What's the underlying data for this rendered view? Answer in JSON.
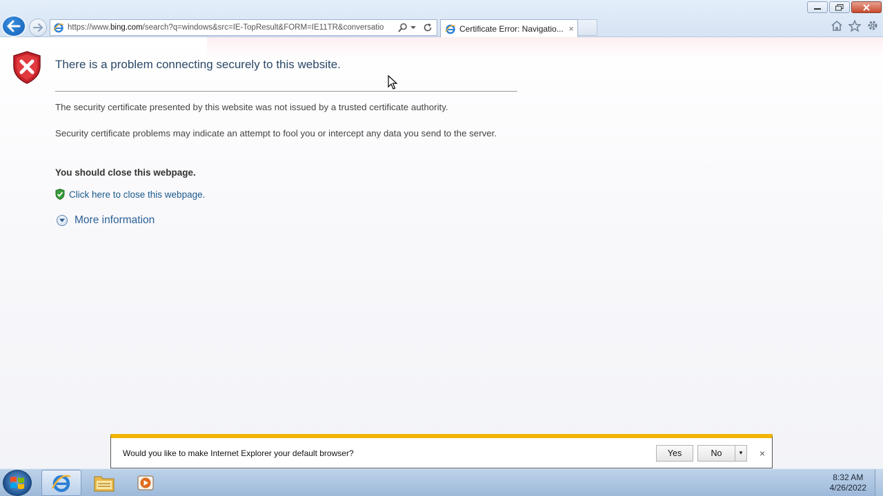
{
  "window": {
    "minimize_icon": "minimize-icon",
    "restore_icon": "restore-icon",
    "close_icon": "close-icon"
  },
  "toolbar": {
    "back_icon": "back-arrow-icon",
    "forward_icon": "forward-arrow-icon",
    "address_prefix": "https://www.",
    "address_domain": "bing.com",
    "address_rest": "/search?q=windows&src=IE-TopResult&FORM=IE11TR&conversatio",
    "search_icon": "search-icon",
    "dropdown_icon": "chevron-down-icon",
    "refresh_icon": "refresh-icon",
    "home_icon": "home-icon",
    "favorites_icon": "star-icon",
    "tools_icon": "gear-icon"
  },
  "tabs": [
    {
      "title": "Certificate Error: Navigatio...",
      "close_label": "×"
    }
  ],
  "page": {
    "title": "There is a problem connecting securely to this website.",
    "paragraph1": "The security certificate presented by this website was not issued by a trusted certificate authority.",
    "paragraph2": "Security certificate problems may indicate an attempt to fool you or intercept any data you send to the server.",
    "warning": "You should close this webpage.",
    "close_link": "Click here to close this webpage.",
    "more_info": "More information"
  },
  "notification": {
    "message": "Would you like to make Internet Explorer your default browser?",
    "yes_label": "Yes",
    "no_label": "No",
    "dropdown_label": "▾",
    "close_label": "×",
    "accent_color": "#f3b300"
  },
  "taskbar": {
    "items": [
      {
        "name": "internet-explorer-icon",
        "active": true
      },
      {
        "name": "file-explorer-icon",
        "active": false
      },
      {
        "name": "media-player-icon",
        "active": false
      }
    ],
    "time": "8:32 AM",
    "date": "4/26/2022"
  },
  "colors": {
    "link": "#1a5a8c",
    "title": "#2b4867",
    "shield_red": "#c8232b"
  }
}
